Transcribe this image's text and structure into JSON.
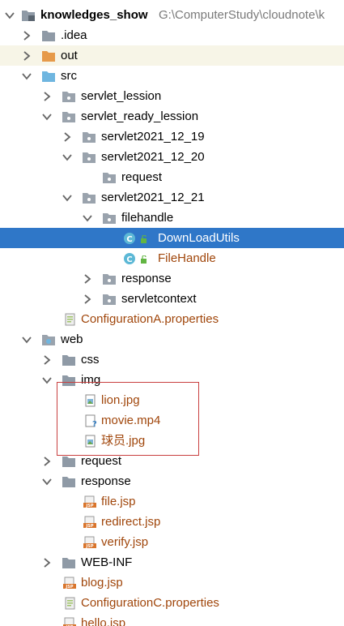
{
  "project": {
    "name": "knowledges_show",
    "path": "G:\\ComputerStudy\\cloudnote\\k"
  },
  "tree": {
    "idea": ".idea",
    "out": "out",
    "src": "src",
    "servlet_lession": "servlet_lession",
    "servlet_ready_lession": "servlet_ready_lession",
    "servlet2021_12_19": "servlet2021_12_19",
    "servlet2021_12_20": "servlet2021_12_20",
    "request_pkg": "request",
    "servlet2021_12_21": "servlet2021_12_21",
    "filehandle": "filehandle",
    "DownLoadUtils": "DownLoadUtils",
    "FileHandle": "FileHandle",
    "response_pkg": "response",
    "servletcontext": "servletcontext",
    "configA": "ConfigurationA.properties",
    "web": "web",
    "css": "css",
    "img": "img",
    "lion": "lion.jpg",
    "movie": "movie.mp4",
    "player": "球员.jpg",
    "request_dir": "request",
    "response_dir": "response",
    "file_jsp": "file.jsp",
    "redirect_jsp": "redirect.jsp",
    "verify_jsp": "verify.jsp",
    "webinf": "WEB-INF",
    "blog_jsp": "blog.jsp",
    "configC": "ConfigurationC.properties",
    "hello_jsp": "hello.jsp"
  },
  "colors": {
    "selection": "#2f77c8",
    "excluded_row": "#f7f5e7",
    "annotation_box": "#c94040",
    "modified_file_text": "#a0460b"
  },
  "icons": {
    "project": "project-folder-icon",
    "package": "package-icon",
    "java_class": "java-class-icon",
    "jsp": "jsp-file-icon",
    "properties": "properties-file-icon",
    "image": "image-file-icon",
    "unknown": "unknown-file-icon"
  }
}
